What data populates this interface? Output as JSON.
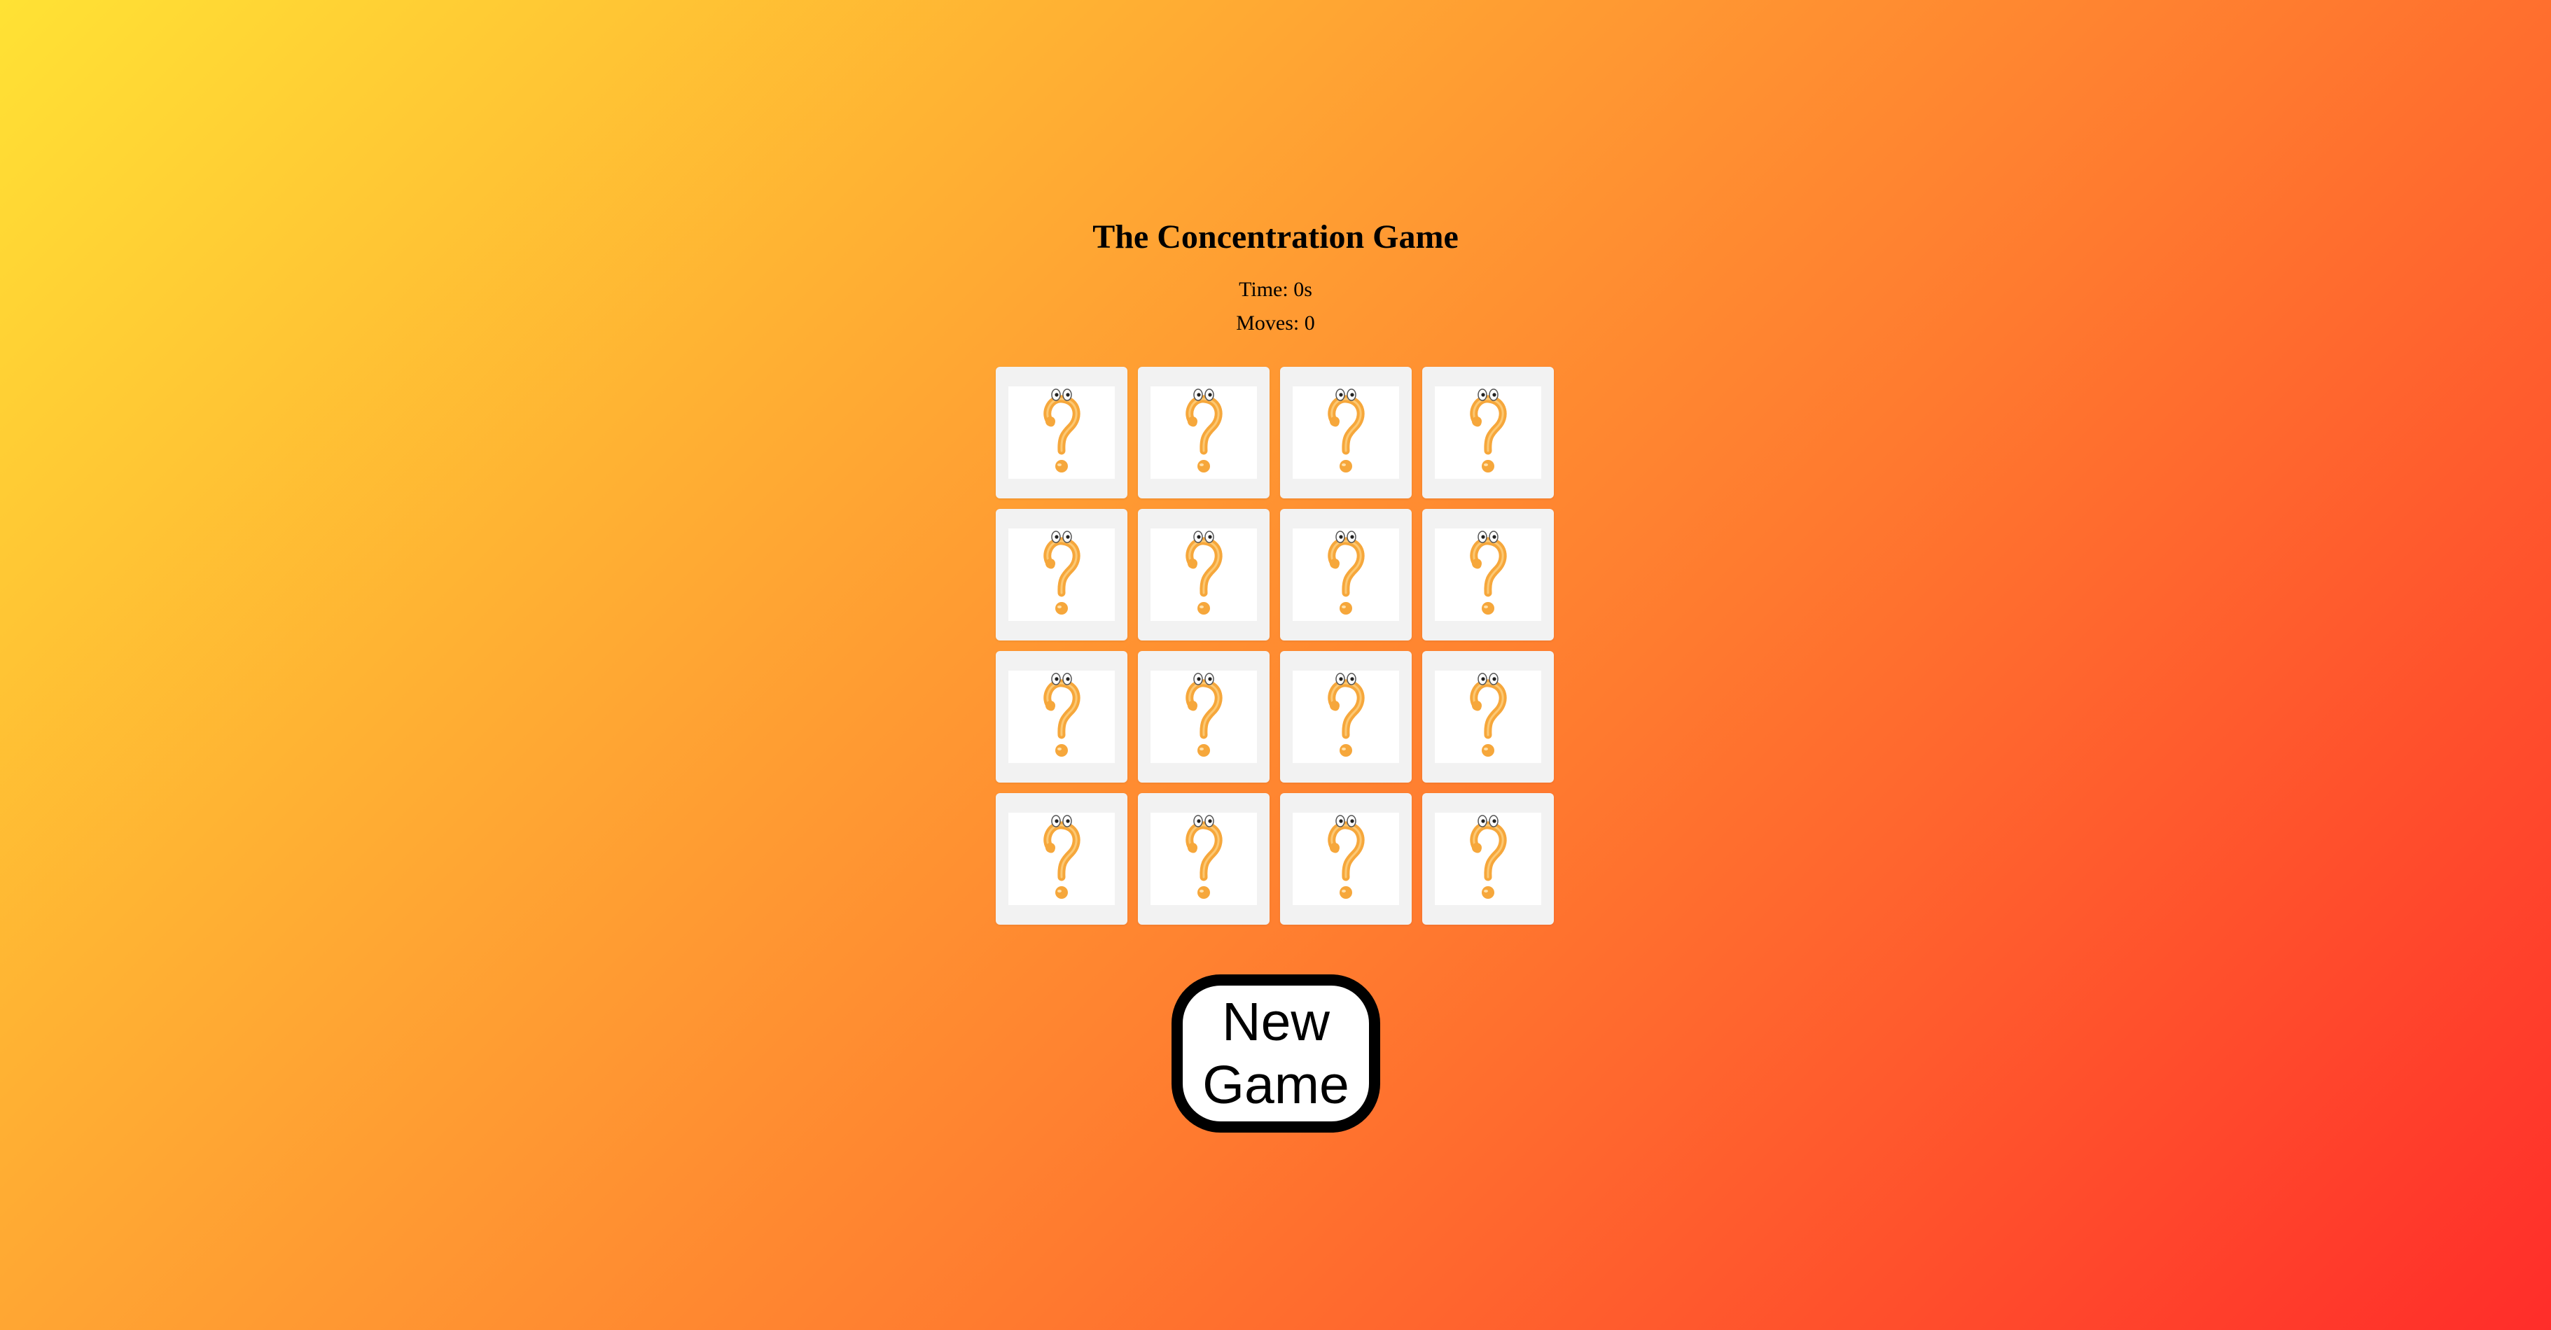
{
  "game": {
    "title": "The Concentration Game",
    "time_text": "Time: 0s",
    "moves_text": "Moves: 0"
  },
  "board": {
    "rows": 4,
    "columns": 4,
    "cards": [
      {
        "state": "face-down",
        "icon": "question-mark-with-eyes-icon"
      },
      {
        "state": "face-down",
        "icon": "question-mark-with-eyes-icon"
      },
      {
        "state": "face-down",
        "icon": "question-mark-with-eyes-icon"
      },
      {
        "state": "face-down",
        "icon": "question-mark-with-eyes-icon"
      },
      {
        "state": "face-down",
        "icon": "question-mark-with-eyes-icon"
      },
      {
        "state": "face-down",
        "icon": "question-mark-with-eyes-icon"
      },
      {
        "state": "face-down",
        "icon": "question-mark-with-eyes-icon"
      },
      {
        "state": "face-down",
        "icon": "question-mark-with-eyes-icon"
      },
      {
        "state": "face-down",
        "icon": "question-mark-with-eyes-icon"
      },
      {
        "state": "face-down",
        "icon": "question-mark-with-eyes-icon"
      },
      {
        "state": "face-down",
        "icon": "question-mark-with-eyes-icon"
      },
      {
        "state": "face-down",
        "icon": "question-mark-with-eyes-icon"
      },
      {
        "state": "face-down",
        "icon": "question-mark-with-eyes-icon"
      },
      {
        "state": "face-down",
        "icon": "question-mark-with-eyes-icon"
      },
      {
        "state": "face-down",
        "icon": "question-mark-with-eyes-icon"
      },
      {
        "state": "face-down",
        "icon": "question-mark-with-eyes-icon"
      }
    ]
  },
  "controls": {
    "new_game_label": "New Game"
  },
  "colors": {
    "gradient_start": "#ffe234",
    "gradient_end": "#ff2d2a",
    "question_mark": "#f6a73b",
    "card_back": "#f2f2f2"
  }
}
